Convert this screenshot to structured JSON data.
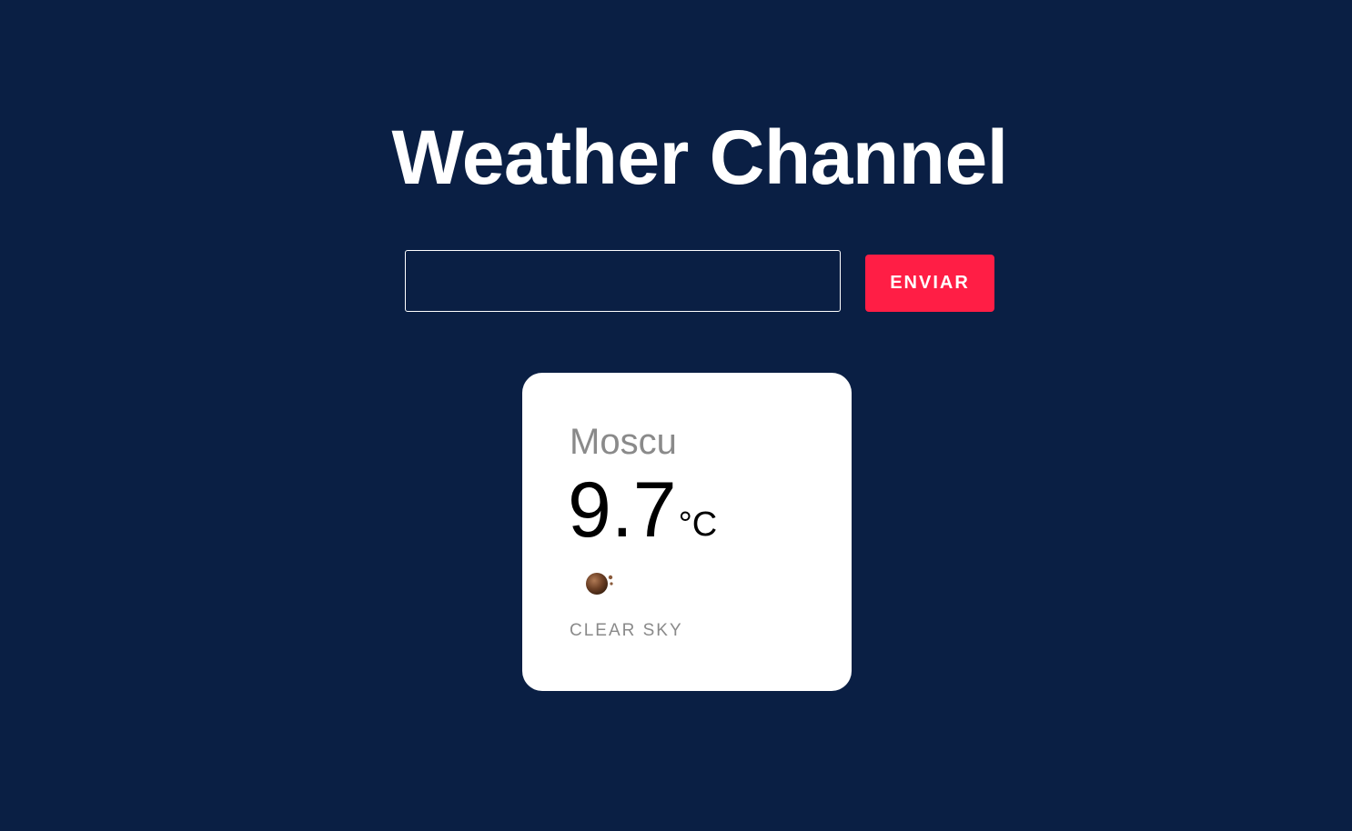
{
  "header": {
    "title": "Weather Channel"
  },
  "search": {
    "value": "",
    "placeholder": "",
    "submit_label": "ENVIAR"
  },
  "weather_card": {
    "city": "Moscu",
    "temperature": "9.7",
    "unit": "°C",
    "icon": "weather-icon",
    "description": "CLEAR SKY"
  },
  "colors": {
    "background": "#0a1f44",
    "accent": "#ff1e45",
    "card": "#ffffff",
    "muted_text": "#8a8a8a"
  }
}
